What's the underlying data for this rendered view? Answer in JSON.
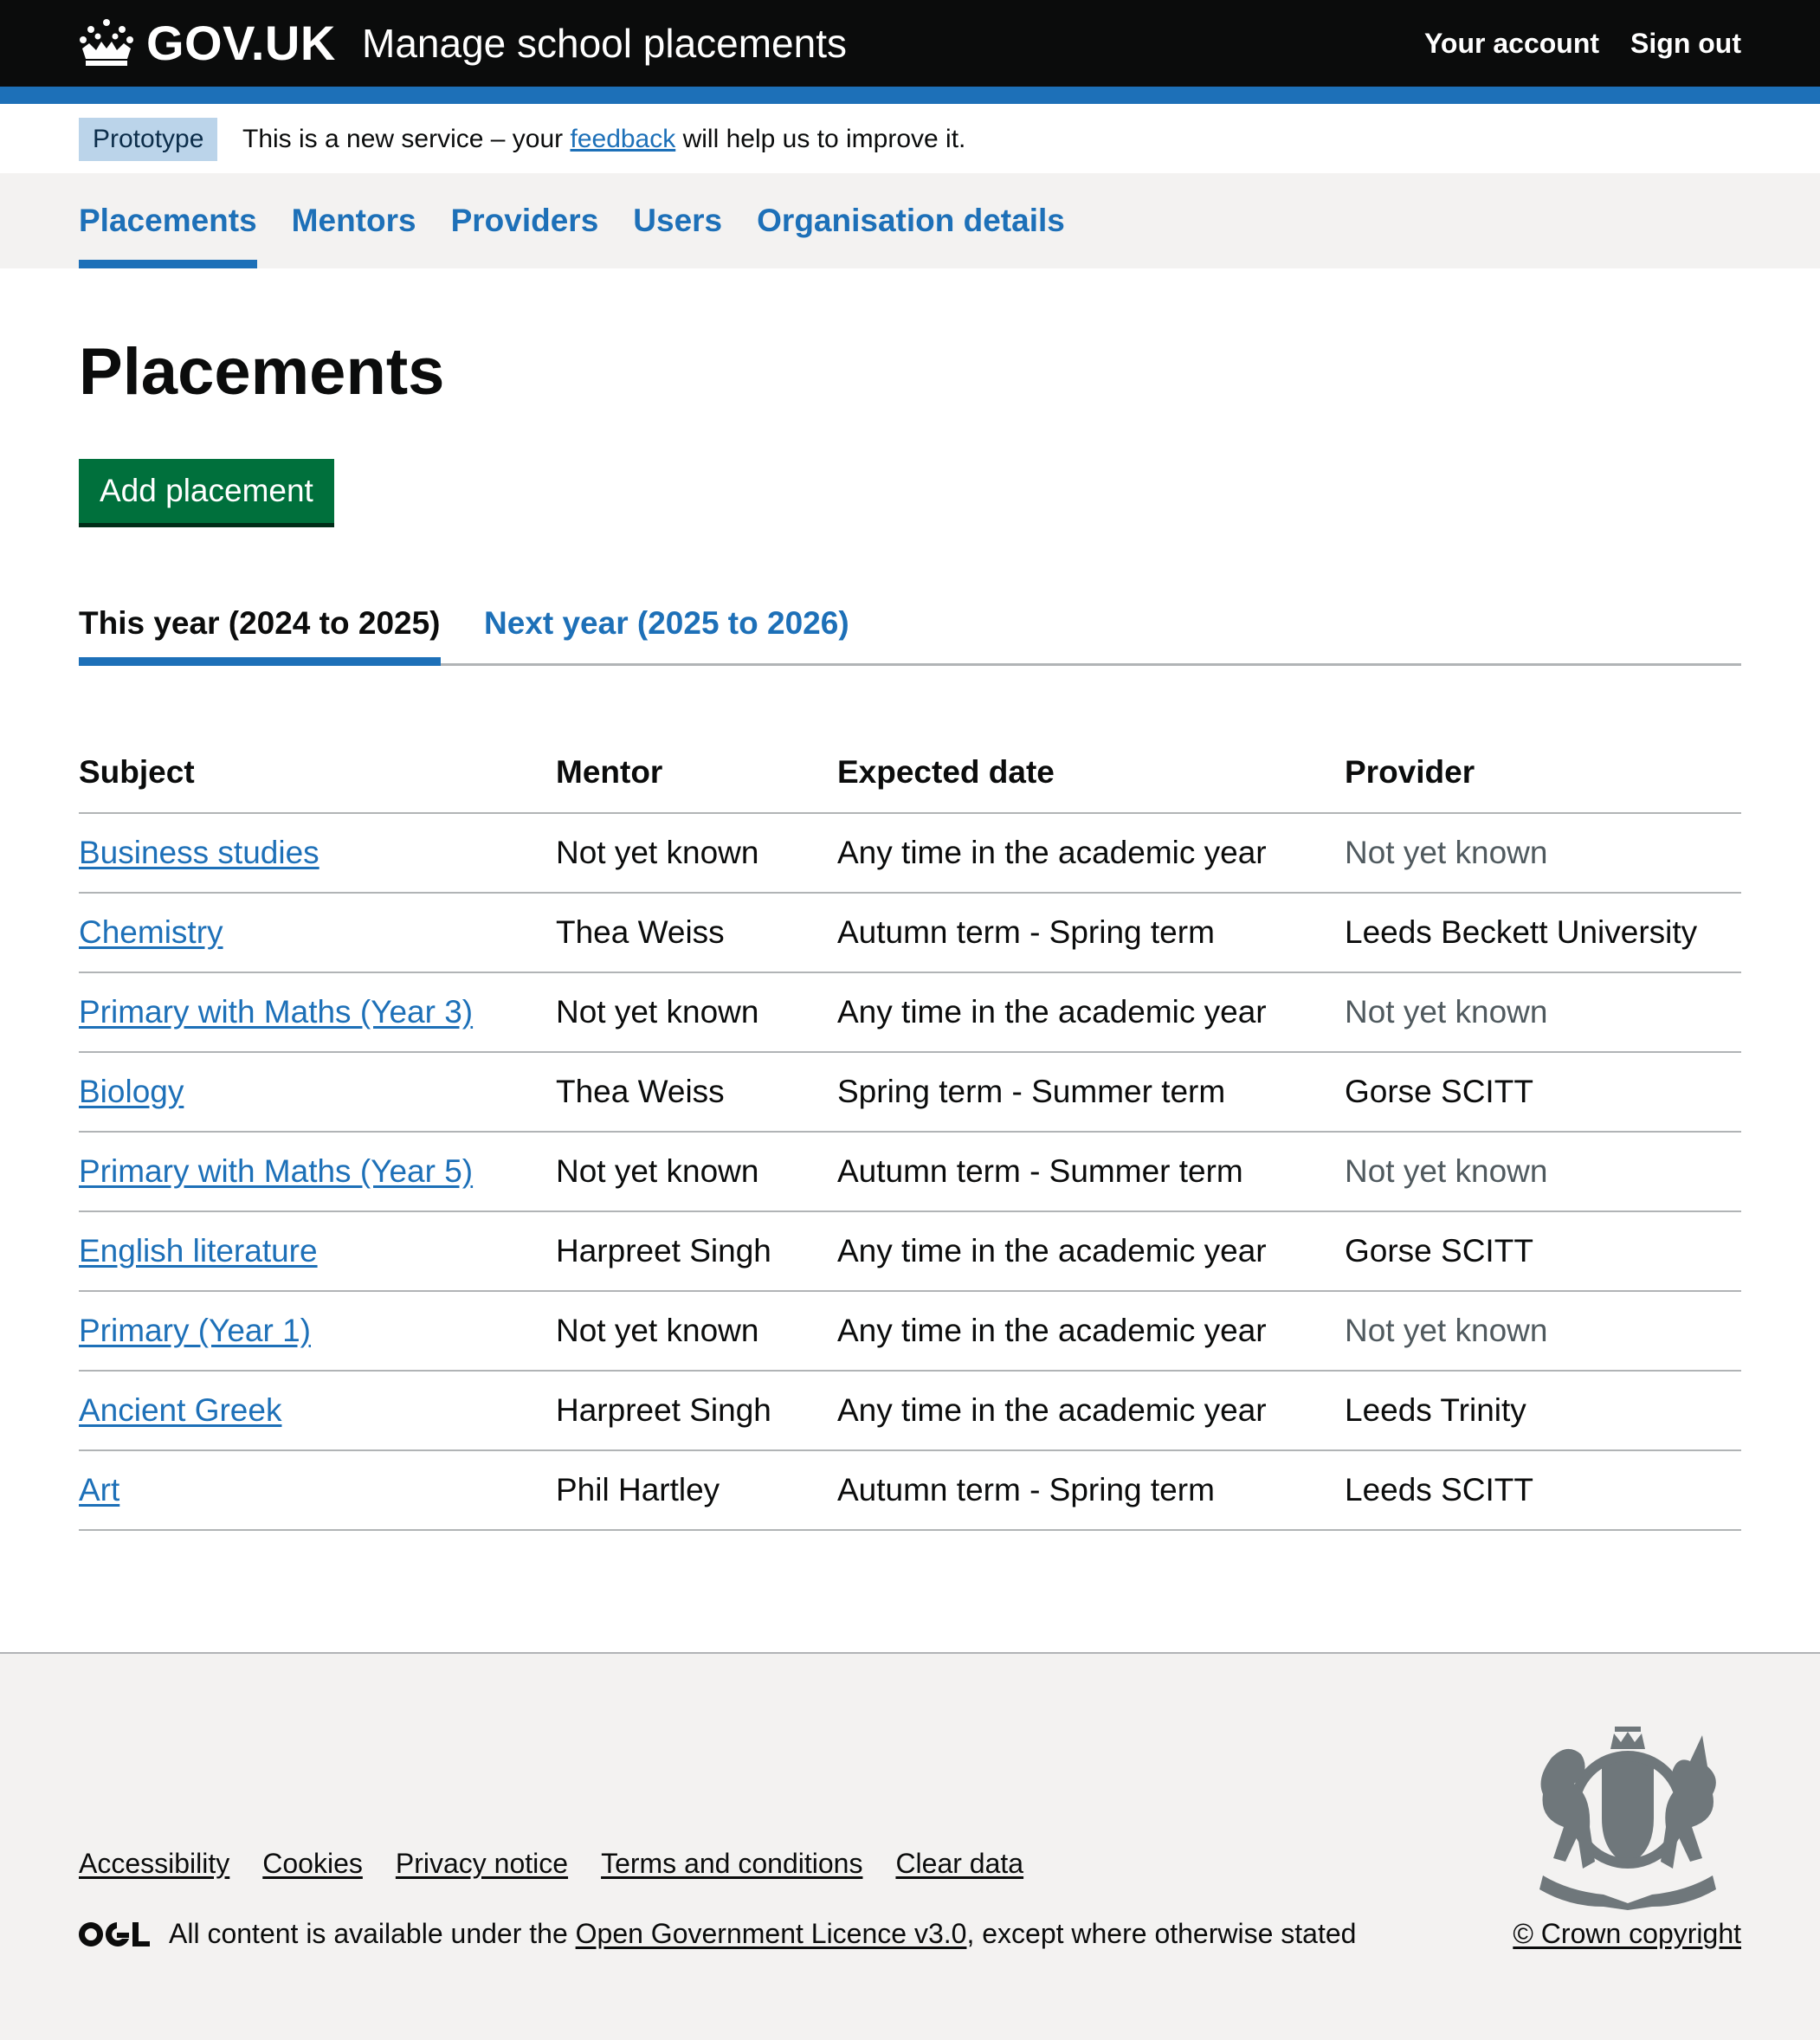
{
  "header": {
    "logo_text": "GOV.UK",
    "service_name": "Manage school placements",
    "account_link": "Your account",
    "sign_out_link": "Sign out"
  },
  "phase_banner": {
    "tag": "Prototype",
    "text_before": "This is a new service – your",
    "link": "feedback",
    "text_after": "will help us to improve it."
  },
  "nav": {
    "items": [
      {
        "label": "Placements",
        "current": true
      },
      {
        "label": "Mentors"
      },
      {
        "label": "Providers"
      },
      {
        "label": "Users"
      },
      {
        "label": "Organisation details"
      }
    ]
  },
  "main": {
    "title": "Placements",
    "add_button": "Add placement",
    "tabs": [
      {
        "label": "This year (2024 to 2025)",
        "active": true
      },
      {
        "label": "Next year (2025 to 2026)"
      }
    ],
    "table": {
      "headers": [
        "Subject",
        "Mentor",
        "Expected date",
        "Provider"
      ],
      "rows": [
        {
          "subject": "Business studies",
          "mentor": "Not yet known",
          "date": "Any time in the academic year",
          "provider": "Not yet known",
          "provider_known": false
        },
        {
          "subject": "Chemistry",
          "mentor": "Thea Weiss",
          "date": "Autumn term - Spring term",
          "provider": "Leeds Beckett University",
          "provider_known": true
        },
        {
          "subject": "Primary with Maths (Year 3)",
          "mentor": "Not yet known",
          "date": "Any time in the academic year",
          "provider": "Not yet known",
          "provider_known": false
        },
        {
          "subject": "Biology",
          "mentor": "Thea Weiss",
          "date": "Spring term - Summer term",
          "provider": "Gorse SCITT",
          "provider_known": true
        },
        {
          "subject": "Primary with Maths (Year 5)",
          "mentor": "Not yet known",
          "date": "Autumn term - Summer term",
          "provider": "Not yet known",
          "provider_known": false
        },
        {
          "subject": "English literature",
          "mentor": "Harpreet Singh",
          "date": "Any time in the academic year",
          "provider": "Gorse SCITT",
          "provider_known": true
        },
        {
          "subject": "Primary (Year 1)",
          "mentor": "Not yet known",
          "date": "Any time in the academic year",
          "provider": "Not yet known",
          "provider_known": false
        },
        {
          "subject": "Ancient Greek",
          "mentor": "Harpreet Singh",
          "date": "Any time in the academic year",
          "provider": "Leeds Trinity",
          "provider_known": true
        },
        {
          "subject": "Art",
          "mentor": "Phil Hartley",
          "date": "Autumn term - Spring term",
          "provider": "Leeds SCITT",
          "provider_known": true
        }
      ]
    }
  },
  "footer": {
    "links": [
      "Accessibility",
      "Cookies",
      "Privacy notice",
      "Terms and conditions",
      "Clear data"
    ],
    "licence_before": "All content is available under the",
    "licence_link": "Open Government Licence v3.0",
    "licence_after": ", except where otherwise stated",
    "copyright": "© Crown copyright"
  },
  "colors": {
    "header_bg": "#0b0c0c",
    "brand_blue": "#1d70b8",
    "button_green": "#00703c",
    "muted_text": "#505a5f",
    "footer_bg": "#f3f2f1"
  }
}
